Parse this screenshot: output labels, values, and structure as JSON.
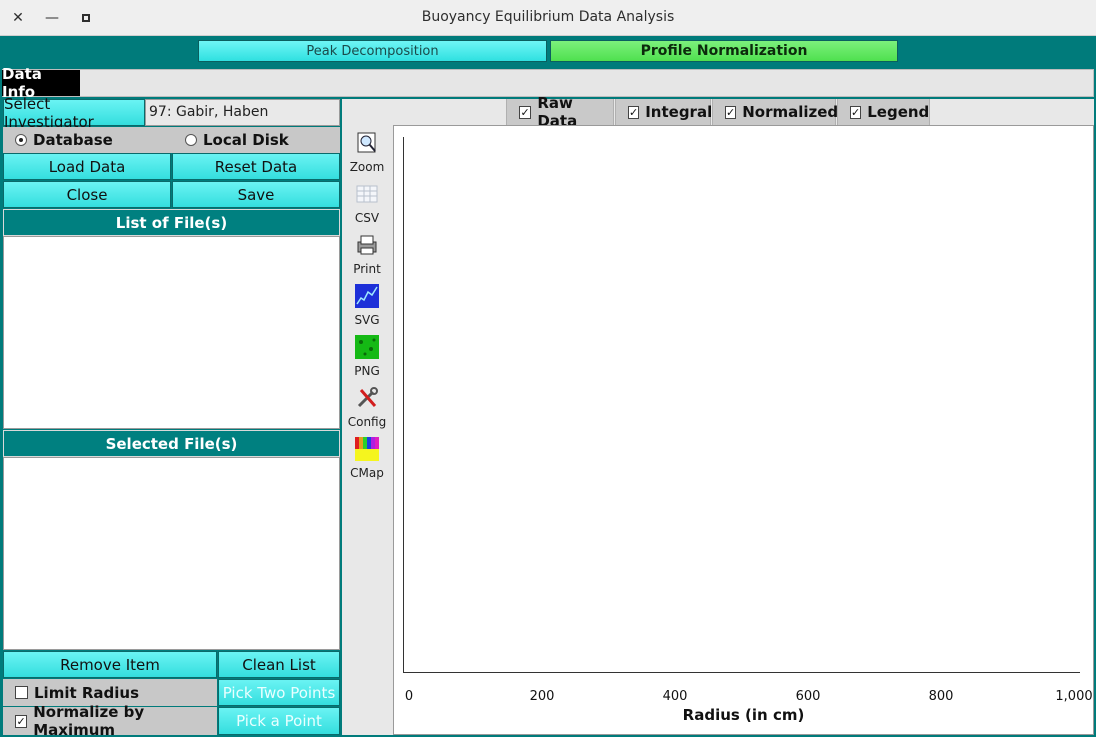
{
  "window": {
    "title": "Buoyancy Equilibrium Data Analysis"
  },
  "mode_tabs": {
    "peak": "Peak Decomposition",
    "profile": "Profile Normalization"
  },
  "data_info": {
    "label": "Data Info"
  },
  "investigator": {
    "button": "Select Investigator",
    "value": "97: Gabir, Haben"
  },
  "source": {
    "database": "Database",
    "local_disk": "Local Disk",
    "selected": "database"
  },
  "buttons": {
    "load": "Load Data",
    "reset": "Reset Data",
    "close": "Close",
    "save": "Save",
    "remove_item": "Remove Item",
    "clean_list": "Clean List",
    "pick_two": "Pick Two Points",
    "pick_one": "Pick a Point"
  },
  "lists": {
    "files_header": "List of File(s)",
    "selected_header": "Selected File(s)"
  },
  "options": {
    "limit_radius": "Limit Radius",
    "limit_radius_checked": false,
    "normalize": "Normalize by Maximum",
    "normalize_checked": true
  },
  "plot_tabs": [
    {
      "label": "Raw Data",
      "checked": true
    },
    {
      "label": "Integral",
      "checked": true
    },
    {
      "label": "Normalized",
      "checked": true
    },
    {
      "label": "Legend",
      "checked": true
    }
  ],
  "tools": [
    {
      "label": "Zoom",
      "icon": "zoom-icon"
    },
    {
      "label": "CSV",
      "icon": "csv-icon"
    },
    {
      "label": "Print",
      "icon": "print-icon"
    },
    {
      "label": "SVG",
      "icon": "svg-icon"
    },
    {
      "label": "PNG",
      "icon": "png-icon"
    },
    {
      "label": "Config",
      "icon": "config-icon"
    },
    {
      "label": "CMap",
      "icon": "cmap-icon"
    }
  ],
  "chart_data": {
    "type": "line",
    "series": [],
    "xlabel": "Radius (in cm)",
    "xticks": [
      "0",
      "200",
      "400",
      "600",
      "800",
      "1,000"
    ],
    "xlim": [
      0,
      1000
    ],
    "grid": true
  },
  "colors": {
    "background": "#007b7b",
    "accent_cyan": "#34dede",
    "accent_green": "#4fe04f",
    "header": "#008080"
  }
}
